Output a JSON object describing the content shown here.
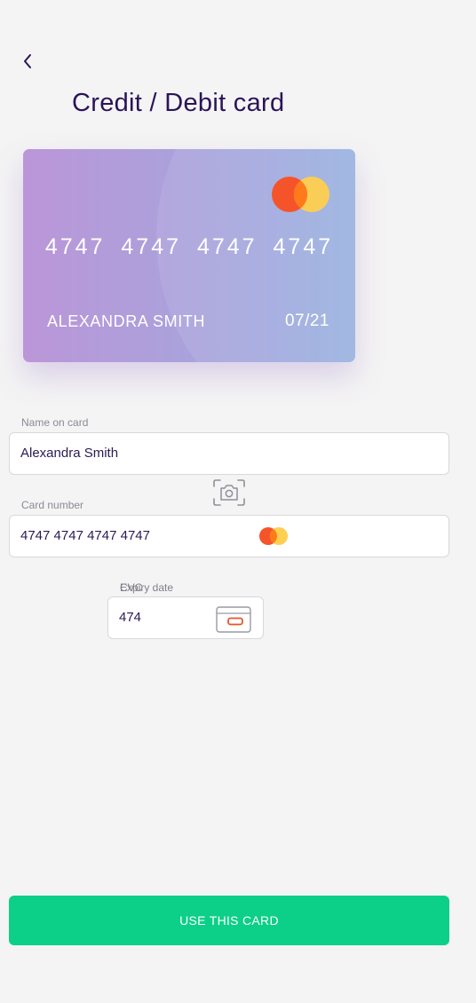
{
  "header": {
    "back_icon": "chevron-left-icon",
    "title": "Credit / Debit card"
  },
  "card_preview": {
    "number": "4747 4747 4747 4747",
    "holder": "ALEXANDRA SMITH",
    "expiry": "07/21",
    "brand_icon": "mastercard-logo-icon",
    "colors": {
      "gradient_start": "#bb96d8",
      "gradient_mid": "#a8a3dc",
      "gradient_end": "#98b1e0",
      "logo_red": "#f5542a",
      "logo_yellow": "#ffcf4f"
    }
  },
  "form": {
    "name": {
      "label": "Name on card",
      "value": "Alexandra Smith"
    },
    "scan_icon": "camera-scan-icon",
    "number": {
      "label": "Card number",
      "value": "4747  4747  4747  4747",
      "brand_icon": "mastercard-logo-icon"
    },
    "expiry": {
      "label": "Expiry date"
    },
    "cvv": {
      "label": "CVC",
      "value": "474",
      "icon": "card-back-cvv-icon"
    }
  },
  "actions": {
    "submit_label": "USE THIS CARD",
    "accent_color": "#0ccf88"
  }
}
